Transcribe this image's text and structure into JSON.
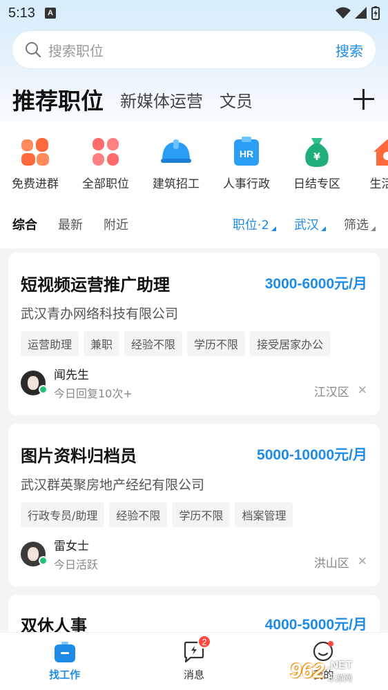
{
  "status_bar": {
    "time": "5:13",
    "a_icon": "A"
  },
  "search": {
    "placeholder": "搜索职位",
    "button": "搜索"
  },
  "header": {
    "title": "推荐职位",
    "tabs": [
      "新媒体运营",
      "文员"
    ]
  },
  "categories": [
    {
      "label": "免费进群",
      "icon": "group-icon"
    },
    {
      "label": "全部职位",
      "icon": "grid-icon"
    },
    {
      "label": "建筑招工",
      "icon": "helmet-icon"
    },
    {
      "label": "人事行政",
      "icon": "hr-icon"
    },
    {
      "label": "日结专区",
      "icon": "money-bag-icon"
    },
    {
      "label": "生活服",
      "icon": "home-icon"
    }
  ],
  "filters": {
    "tabs": [
      "综合",
      "最新",
      "附近"
    ],
    "position": "职位·2",
    "city": "武汉",
    "screen": "筛选"
  },
  "jobs": [
    {
      "title": "短视频运营推广助理",
      "salary": "3000-6000元/月",
      "company": "武汉青办网络科技有限公司",
      "tags": [
        "运营助理",
        "兼职",
        "经验不限",
        "学历不限",
        "接受居家办公"
      ],
      "recruiter": "闻先生",
      "status": "今日回复10次+",
      "area": "江汉区"
    },
    {
      "title": "图片资料归档员",
      "salary": "5000-10000元/月",
      "company": "武汉群英聚房地产经纪有限公司",
      "tags": [
        "行政专员/助理",
        "经验不限",
        "学历不限",
        "档案管理"
      ],
      "recruiter": "雷女士",
      "status": "今日活跃",
      "area": "洪山区"
    },
    {
      "title": "双休人事",
      "salary": "4000-5000元/月"
    }
  ],
  "bottom_nav": {
    "items": [
      "找工作",
      "消息",
      "我的"
    ],
    "message_badge": "2"
  },
  "watermark": {
    "num": "962",
    "net": ".NET",
    "cn": "乐游网"
  },
  "colors": {
    "accent": "#1e8be6",
    "badge": "#ff4a3d",
    "online": "#1fc37a"
  }
}
